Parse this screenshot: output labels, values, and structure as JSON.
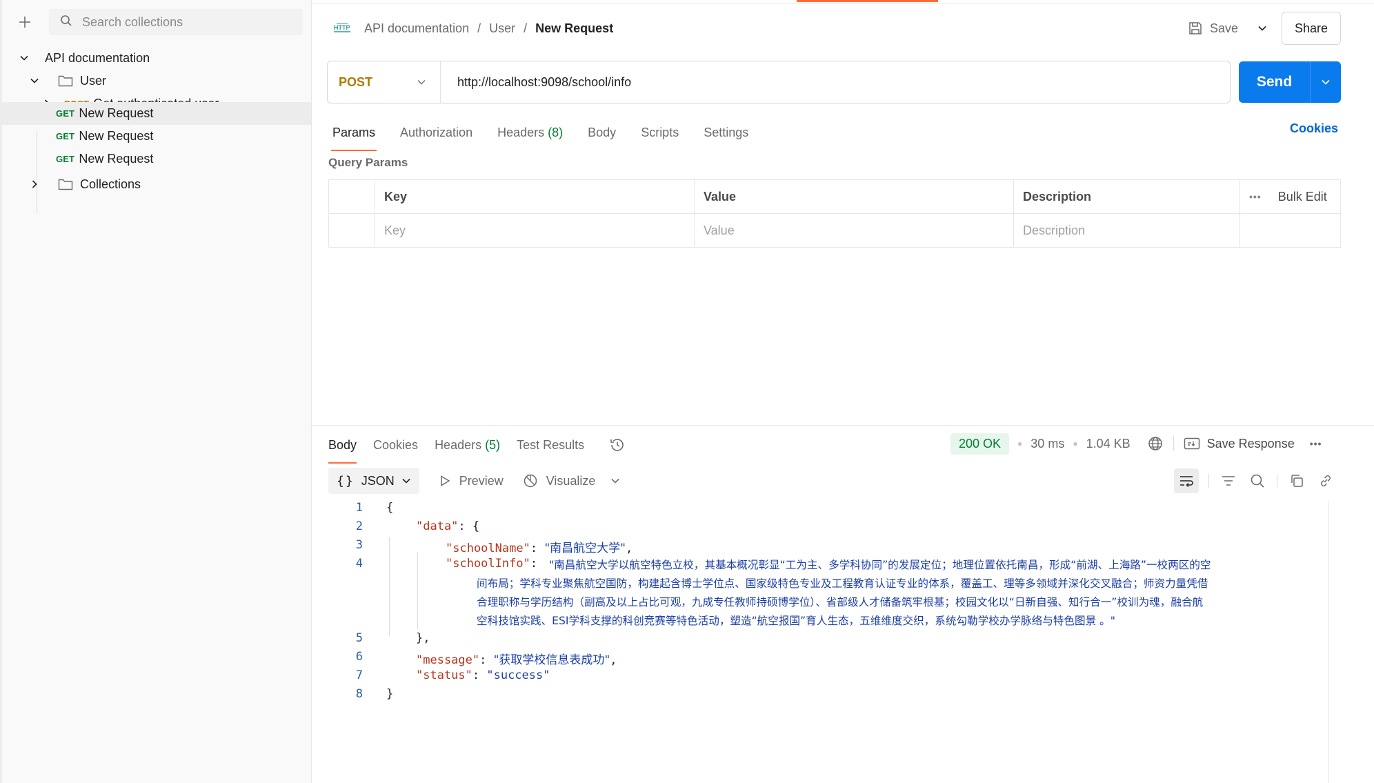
{
  "sidebar": {
    "search_placeholder": "Search collections",
    "tree": {
      "root": "API documentation",
      "folder_user": "User",
      "items": [
        {
          "method": "POST",
          "label": "Get authenticated user"
        },
        {
          "method": "GET",
          "label": "New Request"
        },
        {
          "method": "GET",
          "label": "New Request"
        },
        {
          "method": "GET",
          "label": "New Request"
        }
      ],
      "folder_collections": "Collections"
    }
  },
  "breadcrumb": {
    "collection": "API documentation",
    "folder": "User",
    "current": "New Request"
  },
  "toolbar": {
    "save_label": "Save",
    "share_label": "Share"
  },
  "request": {
    "method": "POST",
    "url": "http://localhost:9098/school/info",
    "send_label": "Send",
    "tabs": {
      "params": "Params",
      "authorization": "Authorization",
      "headers": "Headers",
      "headers_count": "(8)",
      "body": "Body",
      "scripts": "Scripts",
      "settings": "Settings"
    },
    "cookies_label": "Cookies",
    "query_params_title": "Query Params",
    "table": {
      "headers": [
        "Key",
        "Value",
        "Description"
      ],
      "bulk_edit": "Bulk Edit",
      "placeholders": [
        "Key",
        "Value",
        "Description"
      ]
    }
  },
  "response": {
    "tabs": {
      "body": "Body",
      "cookies": "Cookies",
      "headers": "Headers",
      "headers_count": "(5)",
      "test_results": "Test Results"
    },
    "status": "200 OK",
    "time": "30 ms",
    "size": "1.04 KB",
    "save_response": "Save Response",
    "format": "JSON",
    "preview": "Preview",
    "visualize": "Visualize",
    "code": {
      "line_numbers": [
        "1",
        "2",
        "3",
        "4",
        "5",
        "6",
        "7",
        "8"
      ],
      "open_brace": "{",
      "data_key": "\"data\"",
      "data_open": ": {",
      "school_name_key": "\"schoolName\"",
      "school_name_val": "\"南昌航空大学\"",
      "school_info_key": "\"schoolInfo\"",
      "school_info_lines": [
        "\"南昌航空大学以航空特色立校，其基本概况彰显“工为主、多学科协同”的发展定位；地理位置依托南昌，形成“前湖、上海路”一校两区的空",
        "间布局；学科专业聚焦航空国防，构建起含博士学位点、国家级特色专业及工程教育认证专业的体系，覆盖工、理等多领域并深化交叉融合；师资力量凭借",
        "合理职称与学历结构（副高及以上占比可观，九成专任教师持硕博学位）、省部级人才储备筑牢根基；校园文化以“日新自强、知行合一”校训为魂，融合航",
        "空科技馆实践、ESI学科支撑的科创竞赛等特色活动，塑造“航空报国”育人生态，五维维度交织，系统勾勒学校办学脉络与特色图景 。\""
      ],
      "data_close": "},",
      "message_key": "\"message\"",
      "message_val": "\"获取学校信息表成功\"",
      "status_key": "\"status\"",
      "status_val": "\"success\"",
      "close_brace": "}"
    }
  }
}
